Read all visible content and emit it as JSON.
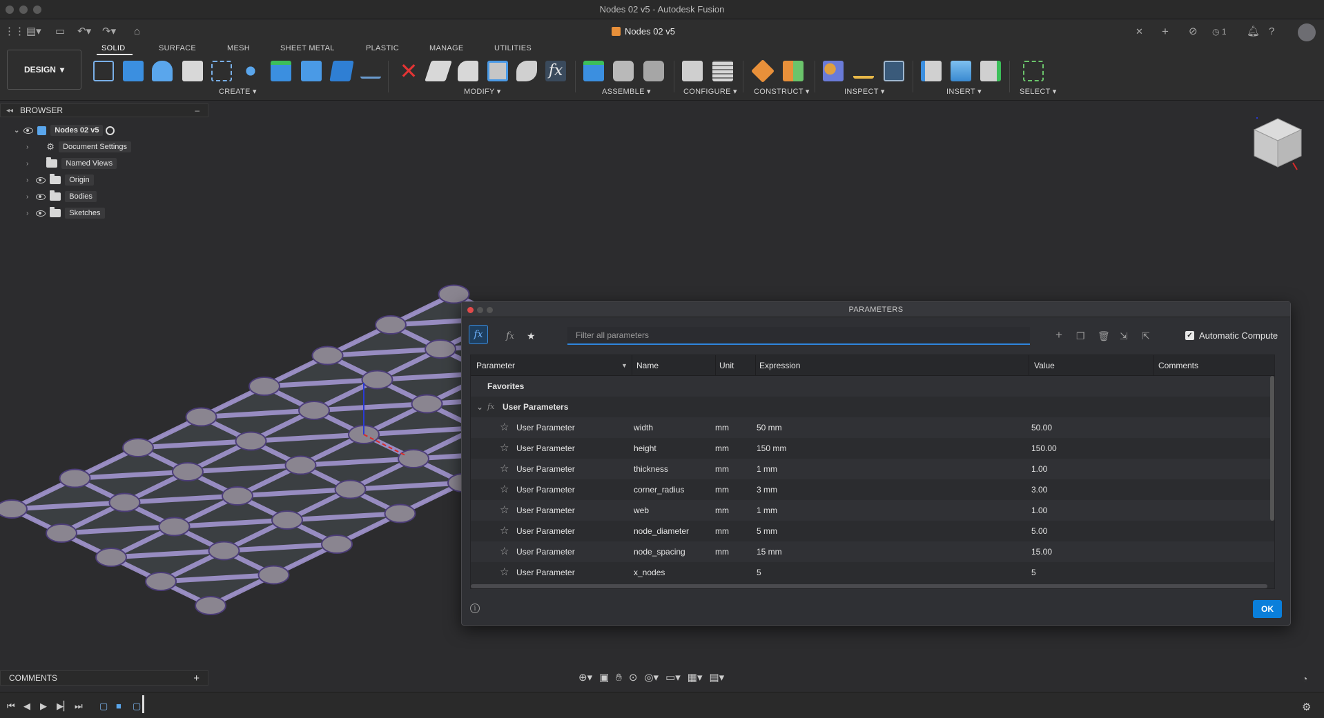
{
  "window_title": "Nodes 02 v5 - Autodesk Fusion",
  "doc_tab": "Nodes 02 v5",
  "header_right": {
    "jobs_count": "1"
  },
  "workspace": "DESIGN",
  "tabs": [
    "SOLID",
    "SURFACE",
    "MESH",
    "SHEET METAL",
    "PLASTIC",
    "MANAGE",
    "UTILITIES"
  ],
  "groups": [
    "CREATE",
    "MODIFY",
    "ASSEMBLE",
    "CONFIGURE",
    "CONSTRUCT",
    "INSPECT",
    "INSERT",
    "SELECT"
  ],
  "browser": {
    "title": "BROWSER",
    "root": "Nodes 02 v5",
    "items": [
      "Document Settings",
      "Named Views",
      "Origin",
      "Bodies",
      "Sketches"
    ]
  },
  "comments_label": "COMMENTS",
  "params": {
    "title": "PARAMETERS",
    "filter_placeholder": "Filter all parameters",
    "auto_compute": "Automatic Compute",
    "columns": [
      "Parameter",
      "Name",
      "Unit",
      "Expression",
      "Value",
      "Comments"
    ],
    "favorites": "Favorites",
    "group": "User Parameters",
    "rows": [
      {
        "type": "User Parameter",
        "name": "width",
        "unit": "mm",
        "expression": "50 mm",
        "value": "50.00"
      },
      {
        "type": "User Parameter",
        "name": "height",
        "unit": "mm",
        "expression": "150 mm",
        "value": "150.00"
      },
      {
        "type": "User Parameter",
        "name": "thickness",
        "unit": "mm",
        "expression": "1 mm",
        "value": "1.00"
      },
      {
        "type": "User Parameter",
        "name": "corner_radius",
        "unit": "mm",
        "expression": "3 mm",
        "value": "3.00"
      },
      {
        "type": "User Parameter",
        "name": "web",
        "unit": "mm",
        "expression": "1 mm",
        "value": "1.00"
      },
      {
        "type": "User Parameter",
        "name": "node_diameter",
        "unit": "mm",
        "expression": "5 mm",
        "value": "5.00"
      },
      {
        "type": "User Parameter",
        "name": "node_spacing",
        "unit": "mm",
        "expression": "15 mm",
        "value": "15.00"
      },
      {
        "type": "User Parameter",
        "name": "x_nodes",
        "unit": "",
        "expression": "5",
        "value": "5"
      }
    ],
    "ok": "OK"
  },
  "colors": {
    "accent": "#0a7fdb",
    "lattice": "#a89ad8",
    "node": "#8a8590",
    "panel": "#2f3034"
  }
}
